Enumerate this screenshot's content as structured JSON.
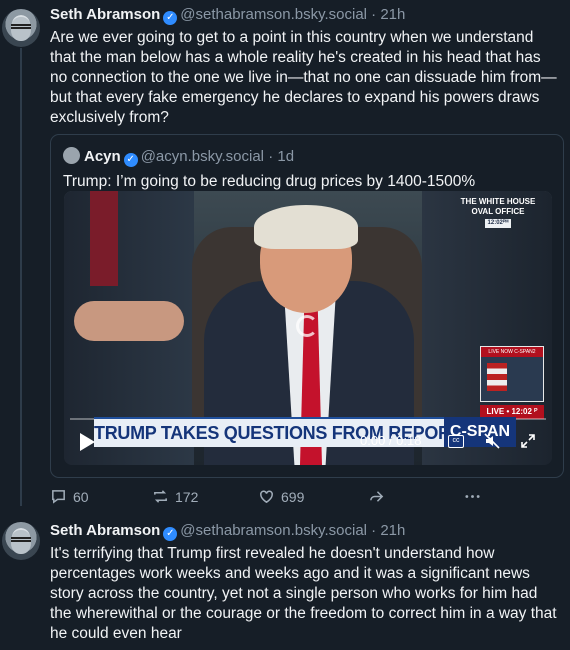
{
  "post1": {
    "author_name": "Seth Abramson",
    "verified_icon": "check-badge-icon",
    "handle": "@sethabramson.bsky.social",
    "time": "· 21h",
    "text": "Are we ever going to get to a point in this country when we understand that the man below has a whole reality he's created in his head that has no connection to the one we live in—that no one can dissuade him from—but that every fake emergency he declares to expand his powers draws exclusively from?",
    "quote": {
      "author_name": "Acyn",
      "handle": "@acyn.bsky.social",
      "time": "· 1d",
      "text": "Trump: I’m going to be reducing drug prices by 1400-1500%",
      "video": {
        "network_line1": "THE WHITE HOUSE",
        "network_line2": "OVAL OFFICE",
        "network_time": "12:02ᴾᴹ",
        "pip_label": "LIVE NOW C-SPAN2",
        "live_label": "LIVE • 12:02 ᴾ",
        "chyron": "TRUMP TAKES QUESTIONS FROM REPORTERS",
        "network": "C-SPAN",
        "time_readout": "0:00 / 0:18",
        "cc_label": "cc"
      }
    },
    "actions": {
      "reply_count": "60",
      "repost_count": "172",
      "like_count": "699"
    }
  },
  "post2": {
    "author_name": "Seth Abramson",
    "handle": "@sethabramson.bsky.social",
    "time": "· 21h",
    "text": "It's terrifying that Trump first revealed he doesn't understand how percentages work weeks and weeks ago and it was a significant news story across the country, yet not a single person who works for him had the wherewithal or the courage or the freedom to correct him in a way that he could even hear"
  },
  "colors": {
    "background": "#161e27",
    "verified": "#2f8cff",
    "muted_text": "#8b98a6",
    "chyron_blue": "#15357a",
    "tie_red": "#c4122c"
  }
}
